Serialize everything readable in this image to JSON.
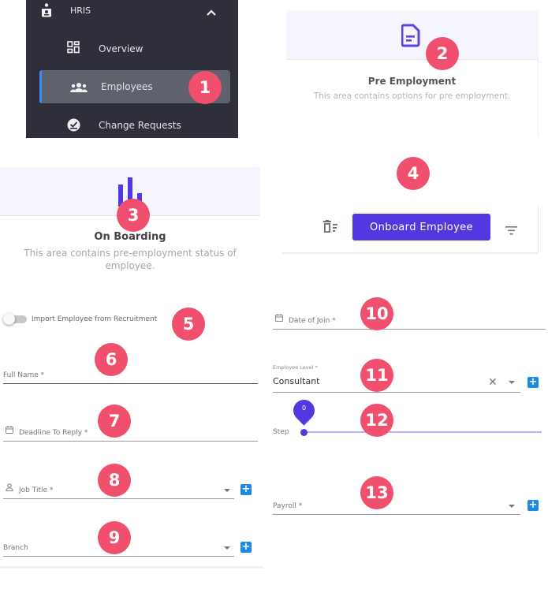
{
  "sidebar": {
    "section_label": "HRIS",
    "items": [
      {
        "label": "Overview",
        "icon": "dashboard-icon"
      },
      {
        "label": "Employees",
        "icon": "people-icon",
        "active": true
      },
      {
        "label": "Change Requests",
        "icon": "check-circle-icon"
      }
    ]
  },
  "pre_employment": {
    "icon": "document-icon",
    "title": "Pre Employment",
    "subtitle": "This area contains options for pre employment."
  },
  "on_boarding": {
    "icon": "bar-chart-icon",
    "title": "On Boarding",
    "subtitle": "This area contains pre-employment status of employee."
  },
  "toolbar": {
    "delete_icon": "delete-list-icon",
    "onboard_label": "Onboard Employee",
    "filter_icon": "filter-icon"
  },
  "form": {
    "import_toggle": {
      "label": "Import Employee from Recruitment",
      "checked": false
    },
    "full_name": {
      "label": "Full Name *",
      "value": ""
    },
    "deadline": {
      "label": "Deadline To Reply *",
      "value": ""
    },
    "job_title": {
      "label": "Job Title *",
      "value": ""
    },
    "branch": {
      "label": "Branch",
      "value": ""
    },
    "date_of_join": {
      "label": "Date of Join *",
      "value": ""
    },
    "employee_level": {
      "label": "Employee Level *",
      "value": "Consultant"
    },
    "step": {
      "label": "Step",
      "value": "0",
      "min": 0
    },
    "payroll": {
      "label": "Payroll *",
      "value": ""
    },
    "add_symbol": "+",
    "clear_symbol": "✕"
  },
  "badges": [
    "1",
    "2",
    "3",
    "4",
    "5",
    "6",
    "7",
    "8",
    "9",
    "10",
    "11",
    "12",
    "13"
  ],
  "colors": {
    "accent": "#5138e0",
    "badge": "#f0506e",
    "sidebar_bg": "#2e2f3a",
    "add_button": "#1e88e5"
  }
}
